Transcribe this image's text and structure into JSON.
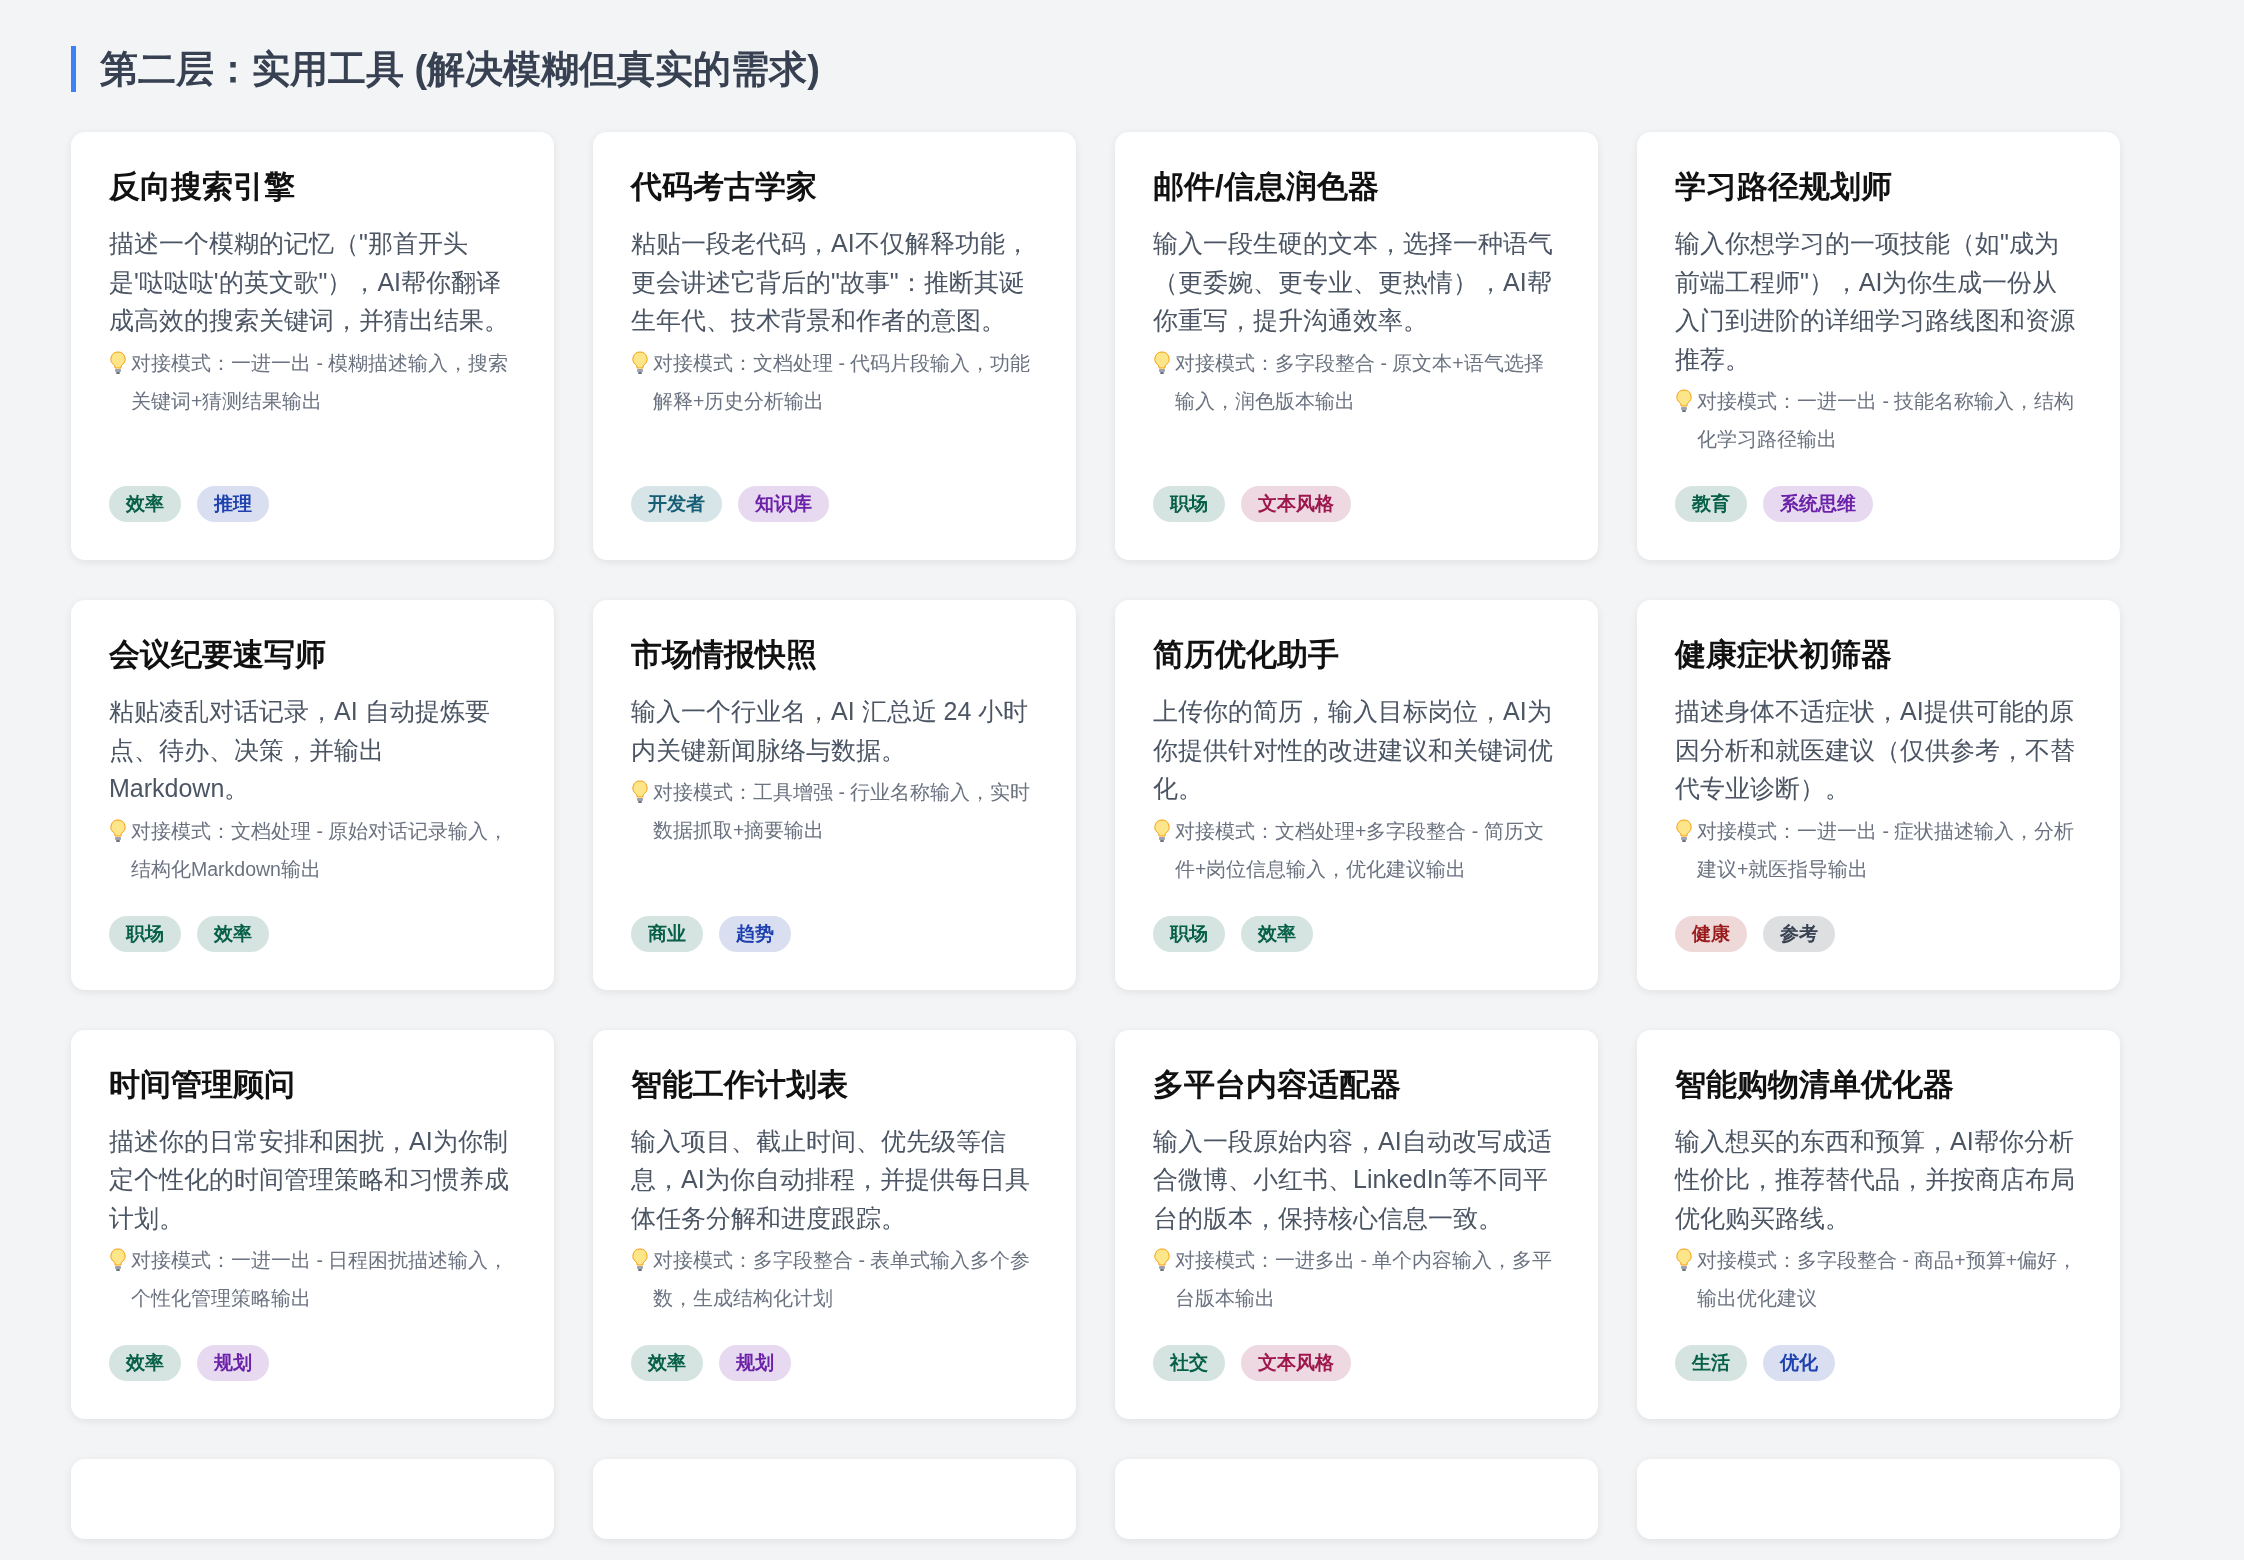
{
  "section_title": "第二层：实用工具 (解决模糊但真实的需求)",
  "cards": [
    {
      "title": "反向搜索引擎",
      "description": "描述一个模糊的记忆（\"那首开头是'哒哒哒'的英文歌\"），AI帮你翻译成高效的搜索关键词，并猜出结果。",
      "note": "对接模式：一进一出 - 模糊描述输入，搜索关键词+猜测结果输出",
      "tags": [
        {
          "label": "效率",
          "color": "#065f46"
        },
        {
          "label": "推理",
          "color": "#1e40af"
        }
      ]
    },
    {
      "title": "代码考古学家",
      "description": "粘贴一段老代码，AI不仅解释功能，更会讲述它背后的\"故事\"：推断其诞生年代、技术背景和作者的意图。",
      "note": "对接模式：文档处理 - 代码片段输入，功能解释+历史分析输出",
      "tags": [
        {
          "label": "开发者",
          "color": "#155e75"
        },
        {
          "label": "知识库",
          "color": "#6b21a8"
        }
      ]
    },
    {
      "title": "邮件/信息润色器",
      "description": "输入一段生硬的文本，选择一种语气（更委婉、更专业、更热情），AI帮你重写，提升沟通效率。",
      "note": "对接模式：多字段整合 - 原文本+语气选择输入，润色版本输出",
      "tags": [
        {
          "label": "职场",
          "color": "#065f46"
        },
        {
          "label": "文本风格",
          "color": "#9d174d"
        }
      ]
    },
    {
      "title": "学习路径规划师",
      "description": "输入你想学习的一项技能（如\"成为前端工程师\"），AI为你生成一份从入门到进阶的详细学习路线图和资源推荐。",
      "note": "对接模式：一进一出 - 技能名称输入，结构化学习路径输出",
      "tags": [
        {
          "label": "教育",
          "color": "#065f46"
        },
        {
          "label": "系统思维",
          "color": "#6b21a8"
        }
      ]
    },
    {
      "title": "会议纪要速写师",
      "description": "粘贴凌乱对话记录，AI 自动提炼要点、待办、决策，并输出 Markdown。",
      "note": "对接模式：文档处理 - 原始对话记录输入，结构化Markdown输出",
      "tags": [
        {
          "label": "职场",
          "color": "#065f46"
        },
        {
          "label": "效率",
          "color": "#065f46"
        }
      ]
    },
    {
      "title": "市场情报快照",
      "description": "输入一个行业名，AI 汇总近 24 小时内关键新闻脉络与数据。",
      "note": "对接模式：工具增强 - 行业名称输入，实时数据抓取+摘要输出",
      "tags": [
        {
          "label": "商业",
          "color": "#065f46"
        },
        {
          "label": "趋势",
          "color": "#1e40af"
        }
      ]
    },
    {
      "title": "简历优化助手",
      "description": "上传你的简历，输入目标岗位，AI为你提供针对性的改进建议和关键词优化。",
      "note": "对接模式：文档处理+多字段整合 - 简历文件+岗位信息输入，优化建议输出",
      "tags": [
        {
          "label": "职场",
          "color": "#065f46"
        },
        {
          "label": "效率",
          "color": "#065f46"
        }
      ]
    },
    {
      "title": "健康症状初筛器",
      "description": "描述身体不适症状，AI提供可能的原因分析和就医建议（仅供参考，不替代专业诊断）。",
      "note": "对接模式：一进一出 - 症状描述输入，分析建议+就医指导输出",
      "tags": [
        {
          "label": "健康",
          "color": "#991b1b"
        },
        {
          "label": "参考",
          "color": "#374151"
        }
      ]
    },
    {
      "title": "时间管理顾问",
      "description": "描述你的日常安排和困扰，AI为你制定个性化的时间管理策略和习惯养成计划。",
      "note": "对接模式：一进一出 - 日程困扰描述输入，个性化管理策略输出",
      "tags": [
        {
          "label": "效率",
          "color": "#065f46"
        },
        {
          "label": "规划",
          "color": "#6b21a8"
        }
      ]
    },
    {
      "title": "智能工作计划表",
      "description": "输入项目、截止时间、优先级等信息，AI为你自动排程，并提供每日具体任务分解和进度跟踪。",
      "note": "对接模式：多字段整合 - 表单式输入多个参数，生成结构化计划",
      "tags": [
        {
          "label": "效率",
          "color": "#065f46"
        },
        {
          "label": "规划",
          "color": "#6b21a8"
        }
      ]
    },
    {
      "title": "多平台内容适配器",
      "description": "输入一段原始内容，AI自动改写成适合微博、小红书、LinkedIn等不同平台的版本，保持核心信息一致。",
      "note": "对接模式：一进多出 - 单个内容输入，多平台版本输出",
      "tags": [
        {
          "label": "社交",
          "color": "#065f46"
        },
        {
          "label": "文本风格",
          "color": "#9d174d"
        }
      ]
    },
    {
      "title": "智能购物清单优化器",
      "description": "输入想买的东西和预算，AI帮你分析性价比，推荐替代品，并按商店布局优化购买路线。",
      "note": "对接模式：多字段整合 - 商品+预算+偏好，输出优化建议",
      "tags": [
        {
          "label": "生活",
          "color": "#065f46"
        },
        {
          "label": "优化",
          "color": "#1e40af"
        }
      ]
    }
  ]
}
